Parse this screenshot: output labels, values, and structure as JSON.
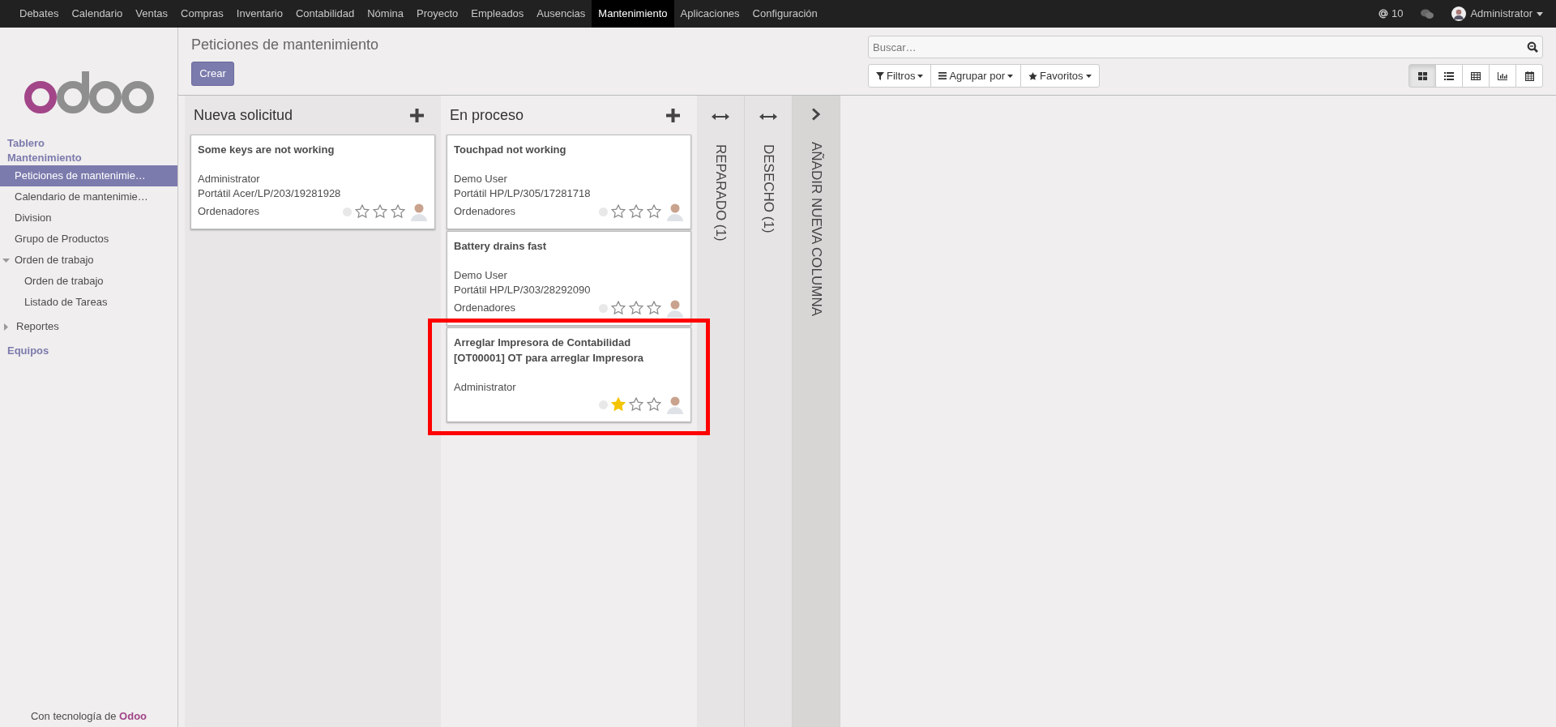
{
  "top_menu": [
    {
      "label": "Debates",
      "selected": false
    },
    {
      "label": "Calendario",
      "selected": false
    },
    {
      "label": "Ventas",
      "selected": false
    },
    {
      "label": "Compras",
      "selected": false
    },
    {
      "label": "Inventario",
      "selected": false
    },
    {
      "label": "Contabilidad",
      "selected": false
    },
    {
      "label": "Nómina",
      "selected": false
    },
    {
      "label": "Proyecto",
      "selected": false
    },
    {
      "label": "Empleados",
      "selected": false
    },
    {
      "label": "Ausencias",
      "selected": false
    },
    {
      "label": "Mantenimiento",
      "selected": true
    },
    {
      "label": "Aplicaciones",
      "selected": false
    },
    {
      "label": "Configuración",
      "selected": false
    }
  ],
  "systray": {
    "mentions": "10",
    "user": "Administrator"
  },
  "sidebar": {
    "sections": [
      {
        "title": "Tablero"
      },
      {
        "title": "Mantenimiento",
        "items": [
          {
            "label": "Peticiones de mantenimie…",
            "selected": true
          },
          {
            "label": "Calendario de mantenimie…",
            "selected": false
          },
          {
            "label": "Division",
            "selected": false
          },
          {
            "label": "Grupo de Productos",
            "selected": false
          },
          {
            "label": "Orden de trabajo",
            "selected": false,
            "expanded": true,
            "children": [
              {
                "label": "Orden de trabajo",
                "selected": false
              },
              {
                "label": "Listado de Tareas",
                "selected": false
              }
            ]
          },
          {
            "label": "Reportes",
            "selected": false,
            "expanded": false
          }
        ]
      },
      {
        "title": "Equipos"
      }
    ],
    "footer": {
      "text": "Con tecnología de",
      "brand": "Odoo"
    }
  },
  "page": {
    "title": "Peticiones de mantenimiento",
    "create_button": "Crear",
    "search": {
      "placeholder": "Buscar…"
    },
    "search_buttons": [
      {
        "kind": "filter",
        "label": "Filtros"
      },
      {
        "kind": "group",
        "label": "Agrupar por"
      },
      {
        "kind": "favorite",
        "label": "Favoritos"
      }
    ],
    "views": [
      {
        "kind": "kanban",
        "selected": true
      },
      {
        "kind": "list",
        "selected": false
      },
      {
        "kind": "pivot",
        "selected": false
      },
      {
        "kind": "graph",
        "selected": false
      },
      {
        "kind": "calendar",
        "selected": false
      }
    ]
  },
  "kanban": {
    "columns": [
      {
        "kind": "open",
        "title": "Nueva solicitud",
        "cards": [
          {
            "title": "Some keys are not working",
            "user": "Administrator",
            "equipment": "Portátil Acer/LP/203/19281928",
            "category": "Ordenadores",
            "stars": 0,
            "highlighted": false
          }
        ]
      },
      {
        "kind": "open",
        "title": "En proceso",
        "cards": [
          {
            "title": "Touchpad not working",
            "user": "Demo User",
            "equipment": "Portátil HP/LP/305/17281718",
            "category": "Ordenadores",
            "stars": 0,
            "highlighted": false
          },
          {
            "title": "Battery drains fast",
            "user": "Demo User",
            "equipment": "Portátil HP/LP/303/28292090",
            "category": "Ordenadores",
            "stars": 0,
            "highlighted": false
          },
          {
            "title": "Arreglar Impresora de Contabilidad",
            "subtitle": "[OT00001] OT para arreglar Impresora",
            "user": "Administrator",
            "stars": 1,
            "highlighted": true
          }
        ]
      },
      {
        "kind": "folded",
        "title": "REPARADO (1)"
      },
      {
        "kind": "folded",
        "title": "DESECHO (1)"
      },
      {
        "kind": "add",
        "title": "AÑADIR NUEVA COLUMNA"
      }
    ]
  }
}
